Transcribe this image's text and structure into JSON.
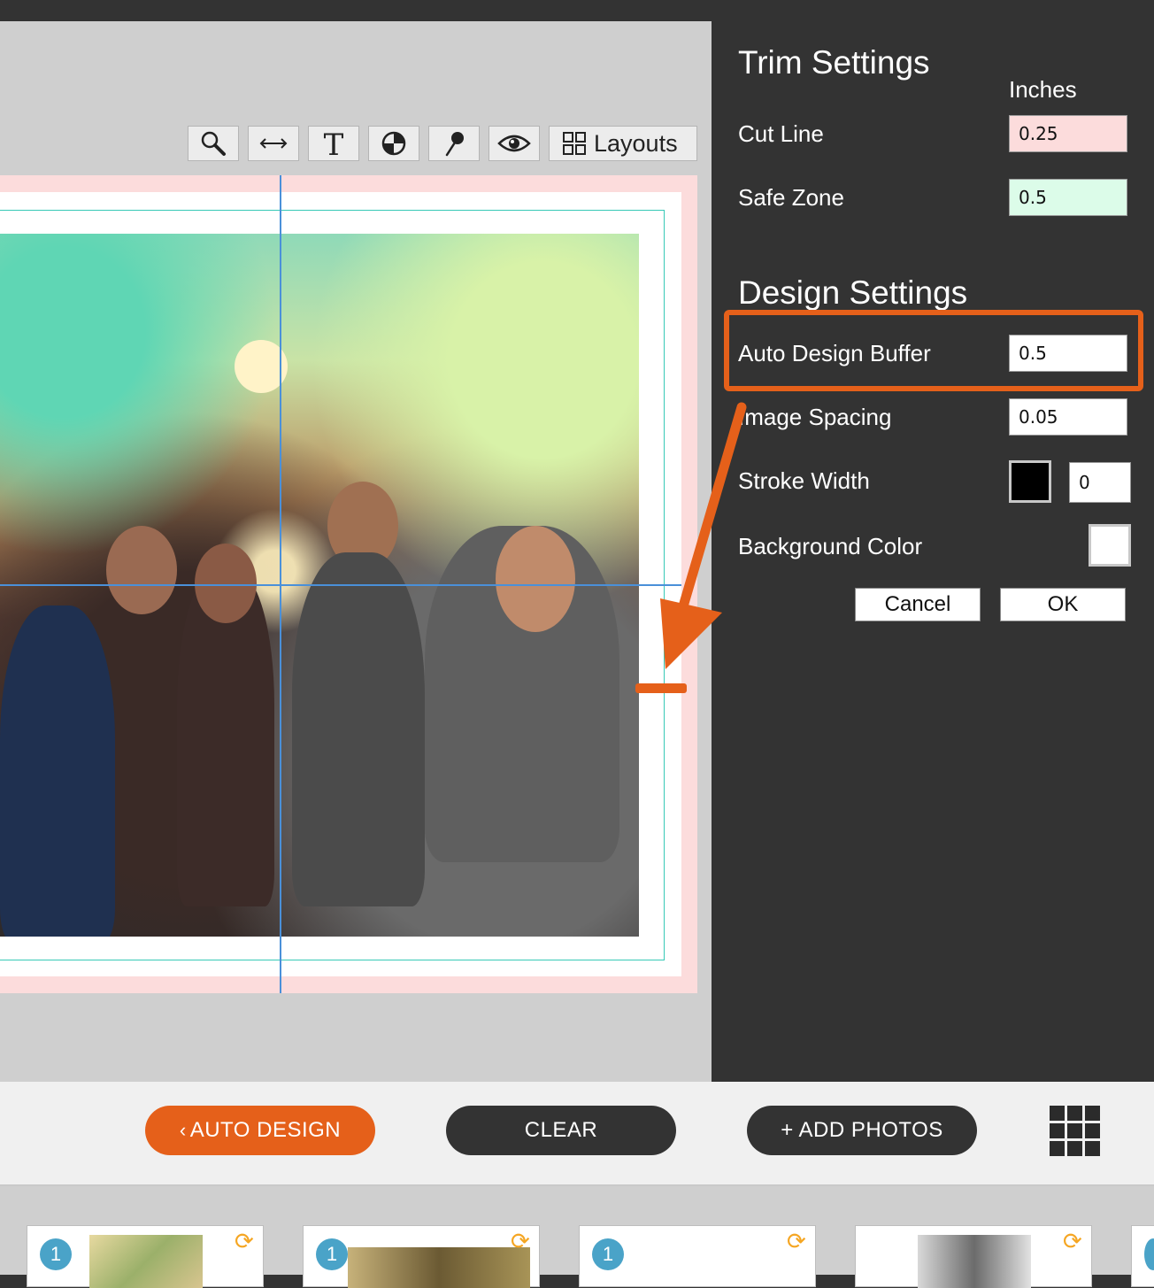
{
  "toolbar": {
    "tools": [
      "zoom-icon",
      "resize-icon",
      "text-icon",
      "shape-icon",
      "pin-icon",
      "preview-icon"
    ],
    "layouts_label": "Layouts"
  },
  "trim_settings": {
    "title": "Trim Settings",
    "units": "Inches",
    "cut_line_label": "Cut Line",
    "cut_line_value": "0.25",
    "cut_line_color": "#fcdcdc",
    "safe_zone_label": "Safe Zone",
    "safe_zone_value": "0.5",
    "safe_zone_color": "#dcfce9"
  },
  "design_settings": {
    "title": "Design Settings",
    "auto_buffer_label": "Auto Design Buffer",
    "auto_buffer_value": "0.5",
    "image_spacing_label": "Image Spacing",
    "image_spacing_value": "0.05",
    "stroke_width_label": "Stroke Width",
    "stroke_color": "#000000",
    "stroke_width_value": "0",
    "background_color_label": "Background Color",
    "background_color": "#ffffff"
  },
  "dialog": {
    "cancel_label": "Cancel",
    "ok_label": "OK"
  },
  "actions": {
    "auto_design_label": "AUTO DESIGN",
    "clear_label": "CLEAR",
    "add_photos_label": "+ ADD PHOTOS"
  },
  "colors": {
    "accent": "#e5601a",
    "panel": "#333333",
    "guide": "#4a90d9",
    "safe_line": "#37c9b6"
  },
  "thumbnails": [
    {
      "count": "1"
    },
    {
      "count": "1"
    },
    {
      "count": "1"
    },
    {
      "count": ""
    }
  ]
}
